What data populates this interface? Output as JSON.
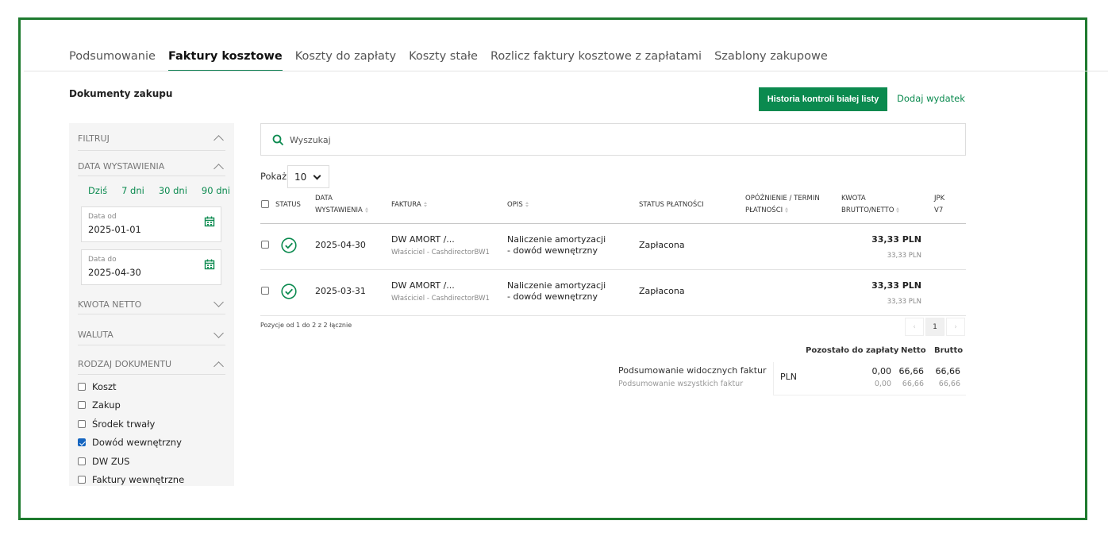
{
  "tabs": [
    "Podsumowanie",
    "Faktury kosztowe",
    "Koszty do zapłaty",
    "Koszty stałe",
    "Rozlicz faktury kosztowe z zapłatami",
    "Szablony zakupowe"
  ],
  "active_tab": "Faktury kosztowe",
  "section_title": "Dokumenty zakupu",
  "actions": {
    "history_button": "Historia kontroli białej listy",
    "add_link": "Dodaj wydatek"
  },
  "colors": {
    "accent": "#0b8a4f",
    "frame": "#1e7a2e",
    "checkbox_checked": "#1565c0"
  },
  "filters": {
    "title": "FILTRUJ",
    "date_section": "DATA WYSTAWIENIA",
    "quick": [
      "Dziś",
      "7 dni",
      "30 dni",
      "90 dni"
    ],
    "date_from": {
      "label": "Data od",
      "value": "2025-01-01"
    },
    "date_to": {
      "label": "Data do",
      "value": "2025-04-30"
    },
    "net_amount": "KWOTA NETTO",
    "currency": "WALUTA",
    "doc_type": "RODZAJ DOKUMENTU",
    "doc_types": [
      {
        "label": "Koszt",
        "checked": false
      },
      {
        "label": "Zakup",
        "checked": false
      },
      {
        "label": "Środek trwały",
        "checked": false
      },
      {
        "label": "Dowód wewnętrzny",
        "checked": true
      },
      {
        "label": "DW ZUS",
        "checked": false
      },
      {
        "label": "Faktury wewnętrzne",
        "checked": false
      }
    ]
  },
  "search": {
    "placeholder": "Wyszukaj"
  },
  "page_size": {
    "label": "Pokaż",
    "value": "10"
  },
  "table": {
    "headers": {
      "status": "STATUS",
      "date_1": "DATA",
      "date_2": "WYSTAWIENIA",
      "invoice": "FAKTURA",
      "desc": "OPIS",
      "pay_status": "STATUS PŁATNOŚCI",
      "delay_1": "OPÓŹNIENIE / TERMIN",
      "delay_2": "PŁATNOŚCI",
      "amount_1": "KWOTA",
      "amount_2": "BRUTTO/NETTO",
      "jpk_1": "JPK",
      "jpk_2": "V7"
    },
    "rows": [
      {
        "date": "2025-04-30",
        "invoice": "DW AMORT /...",
        "owner": "Właściciel - CashdirectorBW1",
        "desc_1": "Naliczenie amortyzacji",
        "desc_2": "- dowód wewnętrzny",
        "pay_status": "Zapłacona",
        "gross": "33,33 PLN",
        "net": "33,33 PLN"
      },
      {
        "date": "2025-03-31",
        "invoice": "DW AMORT /...",
        "owner": "Właściciel - CashdirectorBW1",
        "desc_1": "Naliczenie amortyzacji",
        "desc_2": "- dowód wewnętrzny",
        "pay_status": "Zapłacona",
        "gross": "33,33 PLN",
        "net": "33,33 PLN"
      }
    ]
  },
  "pagination": {
    "text": "Pozycje od 1 do 2 z 2 łącznie",
    "current": "1",
    "prev": "‹",
    "next": "›"
  },
  "summary": {
    "visible_label": "Podsumowanie widocznych faktur",
    "all_label": "Podsumowanie wszystkich faktur",
    "headers": {
      "remaining": "Pozostało do zapłaty",
      "net": "Netto",
      "gross": "Brutto"
    },
    "currency": "PLN",
    "visible": {
      "remaining": "0,00",
      "net": "66,66",
      "gross": "66,66"
    },
    "all": {
      "remaining": "0,00",
      "net": "66,66",
      "gross": "66,66"
    }
  }
}
